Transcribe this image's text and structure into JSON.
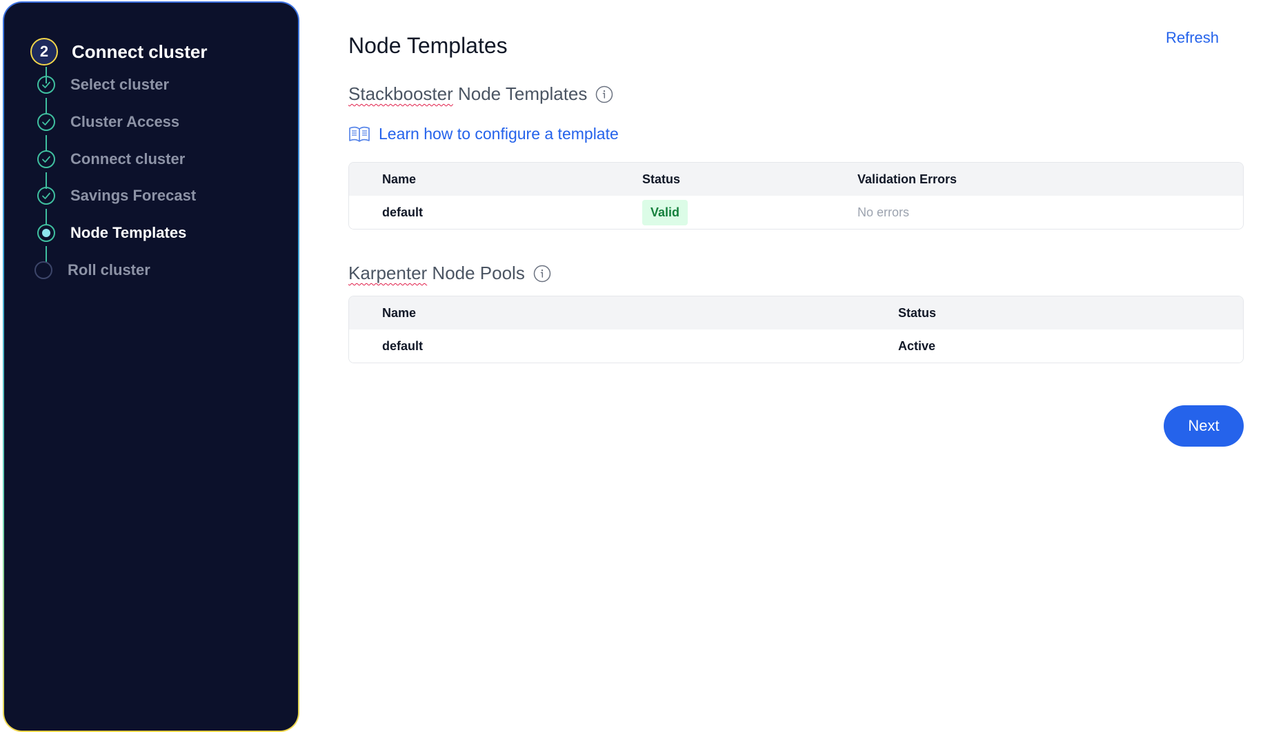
{
  "sidebar": {
    "step_number": "2",
    "step_title": "Connect cluster",
    "items": [
      {
        "label": "Select cluster",
        "state": "done"
      },
      {
        "label": "Cluster Access",
        "state": "done"
      },
      {
        "label": "Connect cluster",
        "state": "done"
      },
      {
        "label": "Savings Forecast",
        "state": "done"
      },
      {
        "label": "Node Templates",
        "state": "current"
      },
      {
        "label": "Roll cluster",
        "state": "todo"
      }
    ]
  },
  "main": {
    "title": "Node Templates",
    "refresh_label": "Refresh",
    "templates_section": {
      "title_brand": "Stackbooster",
      "title_rest": " Node Templates",
      "learn_link": "Learn how to configure a template",
      "columns": [
        "Name",
        "Status",
        "Validation Errors"
      ],
      "rows": [
        {
          "name": "default",
          "status": "Valid",
          "errors": "No errors"
        }
      ]
    },
    "pools_section": {
      "title_brand": "Karpenter",
      "title_rest": " Node Pools",
      "columns": [
        "Name",
        "Status"
      ],
      "rows": [
        {
          "name": "default",
          "status": "Active"
        }
      ]
    },
    "next_label": "Next"
  },
  "colors": {
    "accent": "#2563eb",
    "sidebar_bg": "#0c112b",
    "check_green": "#3fbf9f",
    "valid_badge_bg": "#dcfce7",
    "valid_badge_text": "#15803d"
  }
}
